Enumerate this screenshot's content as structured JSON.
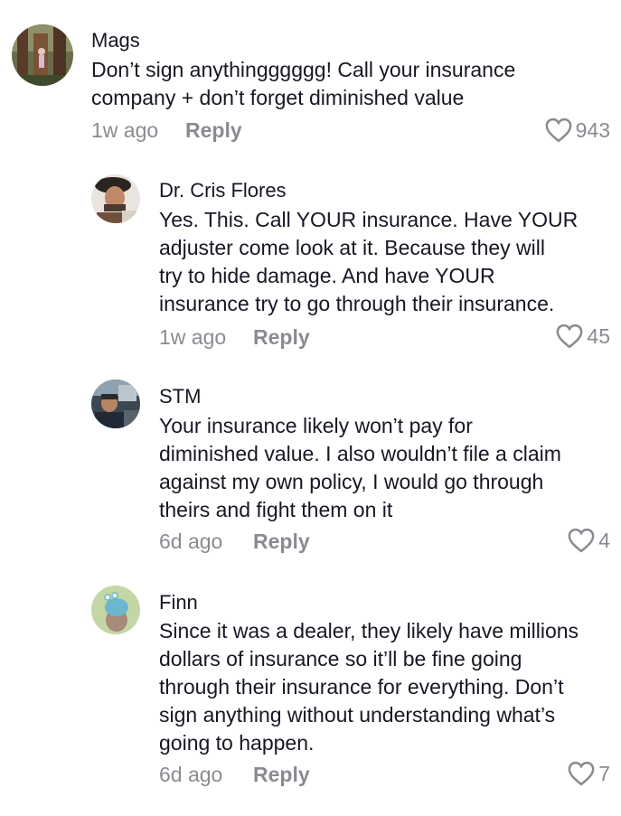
{
  "comments": [
    {
      "username": "Mags",
      "lines": [
        "Don’t sign anythingggggg! Call your insurance",
        "company + don’t forget diminished value"
      ],
      "time": "1w ago",
      "reply_label": "Reply",
      "likes": "943",
      "avatar_icon": "forest-photo-avatar"
    },
    {
      "username": "Dr. Cris Flores",
      "lines": [
        "Yes. This. Call YOUR insurance. Have YOUR",
        "adjuster come look at it. Because they will",
        "try to hide damage. And have YOUR",
        "insurance try to go through their insurance."
      ],
      "time": "1w ago",
      "reply_label": "Reply",
      "likes": "45",
      "avatar_icon": "man-with-hat-avatar"
    },
    {
      "username": "STM",
      "lines": [
        "Your insurance likely won’t pay for",
        "diminished value. I also wouldn’t file a claim",
        "against my own policy, I would go through",
        "theirs and fight them on it"
      ],
      "time": "6d ago",
      "reply_label": "Reply",
      "likes": "4",
      "avatar_icon": "man-in-car-avatar"
    },
    {
      "username": "Finn",
      "lines": [
        "Since it was a dealer, they likely have millions",
        "dollars of insurance so it’ll be fine going",
        "through their insurance for everything. Don’t",
        "sign anything without understanding what’s",
        "going to happen."
      ],
      "time": "6d ago",
      "reply_label": "Reply",
      "likes": "7",
      "avatar_icon": "cartoon-creature-avatar"
    }
  ]
}
